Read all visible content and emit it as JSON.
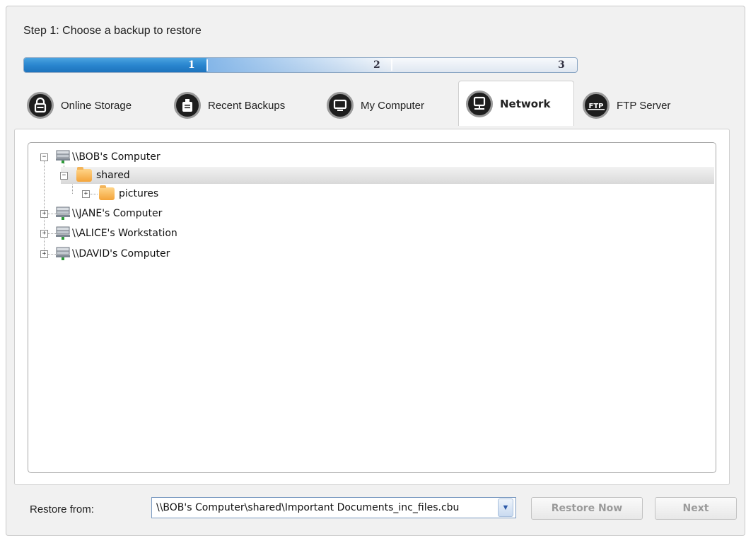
{
  "step_title": "Step 1: Choose a backup to restore",
  "progress": {
    "segments": [
      "1",
      "2",
      "3"
    ],
    "current_step": 1,
    "fill_fraction": 0.33
  },
  "tabs": [
    {
      "label": "Online Storage",
      "icon": "lock-icon",
      "active": false
    },
    {
      "label": "Recent Backups",
      "icon": "briefcase-icon",
      "active": false
    },
    {
      "label": "My Computer",
      "icon": "monitor-icon",
      "active": false
    },
    {
      "label": "Network",
      "icon": "network-monitor-icon",
      "active": true
    },
    {
      "label": "FTP Server",
      "icon": "ftp-icon",
      "active": false
    }
  ],
  "tree": {
    "nodes": [
      {
        "label": "\\\\BOB's Computer",
        "type": "computer",
        "level": 0,
        "expanded": true
      },
      {
        "label": "shared",
        "type": "folder",
        "level": 1,
        "expanded": true,
        "selected": true
      },
      {
        "label": "pictures",
        "type": "folder",
        "level": 2,
        "expanded": false
      },
      {
        "label": "\\\\JANE's Computer",
        "type": "computer",
        "level": 0,
        "expanded": false
      },
      {
        "label": "\\\\ALICE's Workstation",
        "type": "computer",
        "level": 0,
        "expanded": false
      },
      {
        "label": "\\\\DAVID's Computer",
        "type": "computer",
        "level": 0,
        "expanded": false
      }
    ]
  },
  "footer": {
    "restore_from_label": "Restore from:",
    "restore_from_value": "\\\\BOB's Computer\\shared\\Important Documents_inc_files.cbu",
    "restore_now_label": "Restore Now",
    "next_label": "Next"
  },
  "colors": {
    "progress_fill": "#2a86cf",
    "selected_row": "#dcdcdc",
    "folder": "#f4a43a"
  }
}
